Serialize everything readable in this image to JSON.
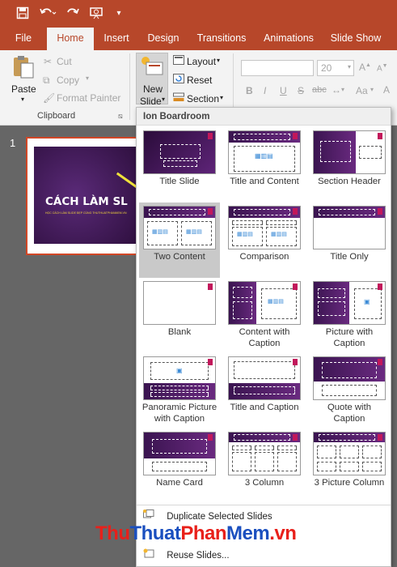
{
  "quick_access": {
    "icons": [
      "save-icon",
      "undo-icon",
      "redo-icon",
      "present-icon",
      "customize-icon"
    ]
  },
  "tabs": [
    {
      "label": "File"
    },
    {
      "label": "Home"
    },
    {
      "label": "Insert"
    },
    {
      "label": "Design"
    },
    {
      "label": "Transitions"
    },
    {
      "label": "Animations"
    },
    {
      "label": "Slide Show"
    }
  ],
  "ribbon": {
    "paste": "Paste",
    "cut": "Cut",
    "copy": "Copy",
    "format_painter": "Format Painter",
    "clipboard": "Clipboard",
    "new_slide_1": "New",
    "new_slide_2": "Slide",
    "layout": "Layout",
    "reset": "Reset",
    "section": "Section",
    "font_size": "20",
    "bold": "B",
    "italic": "I",
    "underline": "U",
    "strike": "S",
    "strikeout": "abc",
    "aa": "Aa"
  },
  "slide_pane": {
    "number": "1",
    "title": "CÁCH LÀM SL",
    "subtitle": "HỌC CÁCH LÀM SLIDE ĐẸP CÙNG THUTHUATPHANMEM.VN"
  },
  "gallery": {
    "theme": "Ion Boardroom",
    "layouts": [
      {
        "line1": "Title Slide",
        "line2": ""
      },
      {
        "line1": "Title and Content",
        "line2": ""
      },
      {
        "line1": "Section Header",
        "line2": ""
      },
      {
        "line1": "Two Content",
        "line2": ""
      },
      {
        "line1": "Comparison",
        "line2": ""
      },
      {
        "line1": "Title Only",
        "line2": ""
      },
      {
        "line1": "Blank",
        "line2": ""
      },
      {
        "line1": "Content with",
        "line2": "Caption"
      },
      {
        "line1": "Picture with",
        "line2": "Caption"
      },
      {
        "line1": "Panoramic Picture",
        "line2": "with Caption"
      },
      {
        "line1": "Title and Caption",
        "line2": ""
      },
      {
        "line1": "Quote with",
        "line2": "Caption"
      },
      {
        "line1": "Name Card",
        "line2": ""
      },
      {
        "line1": "3 Column",
        "line2": ""
      },
      {
        "line1": "3 Picture Column",
        "line2": ""
      }
    ],
    "selected": "Two Content",
    "menu": {
      "duplicate": "Duplicate Selected Slides",
      "reuse": "Reuse Slides..."
    }
  },
  "watermark": {
    "part1": "Thu",
    "part2": "Thuat",
    "part3": "Phan",
    "part4": "Mem",
    ".vn": ".vn",
    "dotvn": ".vn"
  },
  "colors": {
    "accent": "#b7472a",
    "selected": "#c9c9c9",
    "theme_purple": "#4a1a5e",
    "watermark_red": "#e8201a",
    "watermark_blue": "#1a4fbf"
  }
}
